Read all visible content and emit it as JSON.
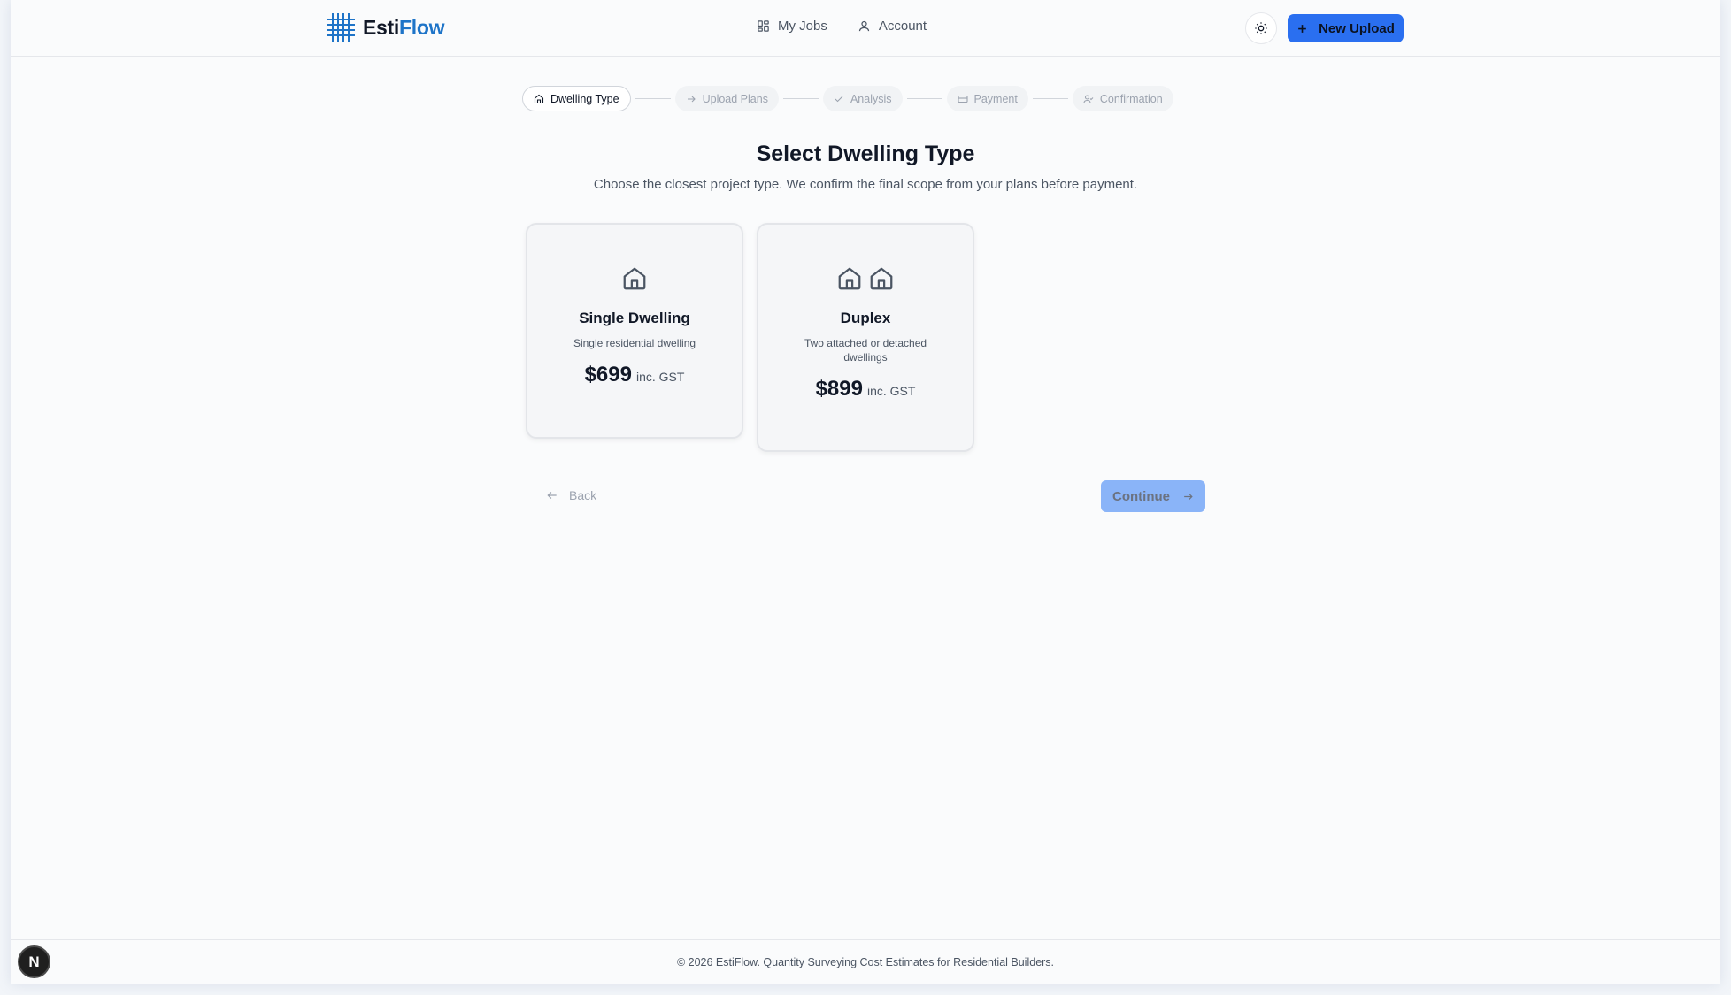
{
  "app": {
    "logo_part1": "Esti",
    "logo_part2": "Flow",
    "logo_icon": "grid-icon",
    "brand_color": "#1e74c8",
    "accent_color": "#2a6ff0"
  },
  "nav": {
    "items": [
      {
        "label": "My Jobs",
        "icon": "dashboard-grid-icon"
      },
      {
        "label": "Account",
        "icon": "user-icon"
      }
    ],
    "theme_toggle_icon": "sun-icon",
    "new_upload_label": "New Upload",
    "new_upload_icon": "plus-icon"
  },
  "stepper": {
    "steps": [
      {
        "label": "Dwelling Type",
        "icon": "home-icon",
        "active": true
      },
      {
        "label": "Upload Plans",
        "icon": "arrow-right-icon",
        "active": false
      },
      {
        "label": "Analysis",
        "icon": "check-icon",
        "active": false
      },
      {
        "label": "Payment",
        "icon": "credit-card-icon",
        "active": false
      },
      {
        "label": "Confirmation",
        "icon": "user-check-icon",
        "active": false
      }
    ]
  },
  "main": {
    "title": "Select Dwelling Type",
    "subtitle": "Choose the closest project type. We confirm the final scope from your plans before payment.",
    "cards": [
      {
        "title": "Single Dwelling",
        "description": "Single residential dwelling",
        "price": "$699",
        "price_note": "inc. GST",
        "icon": "house-icon"
      },
      {
        "title": "Duplex",
        "description": "Two attached or detached dwellings",
        "price": "$899",
        "price_note": "inc. GST",
        "icon": "two-houses-icon"
      }
    ],
    "back_label": "Back",
    "continue_label": "Continue"
  },
  "footer": {
    "text": "© 2026 EstiFlow. Quantity Surveying Cost Estimates for Residential Builders."
  },
  "badge": {
    "letter": "N"
  }
}
